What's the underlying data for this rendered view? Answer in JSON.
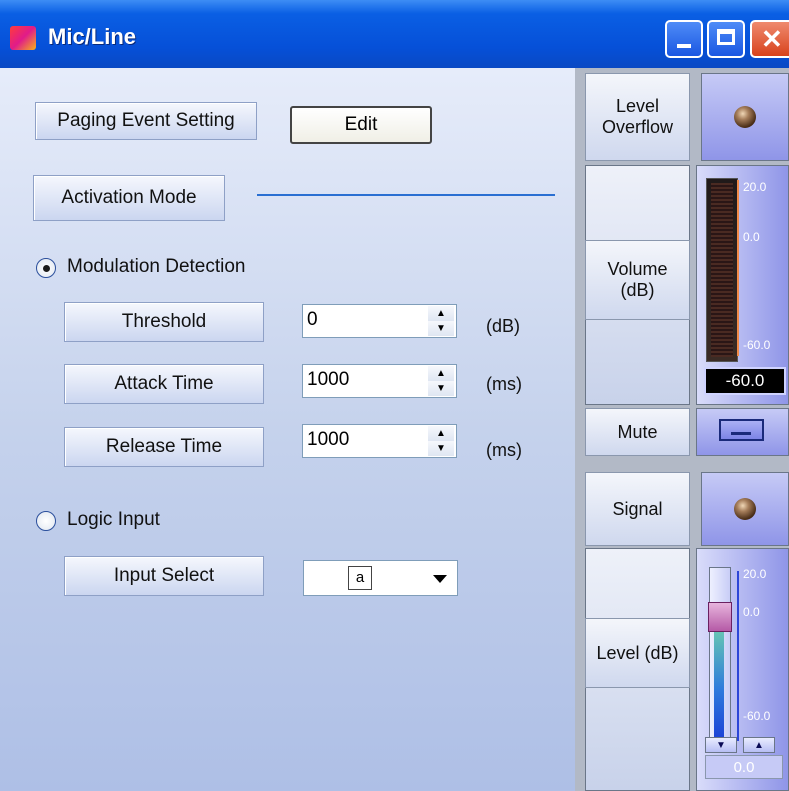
{
  "window": {
    "title": "Mic/Line"
  },
  "paging": {
    "label": "Paging Event Setting",
    "edit_label": "Edit"
  },
  "activation": {
    "label": "Activation Mode",
    "modulation": {
      "label": "Modulation Detection",
      "checked": true
    },
    "threshold": {
      "label": "Threshold",
      "value": "0",
      "unit": "(dB)"
    },
    "attack": {
      "label": "Attack Time",
      "value": "1000",
      "unit": "(ms)"
    },
    "release": {
      "label": "Release Time",
      "value": "1000",
      "unit": "(ms)"
    },
    "logic": {
      "label": "Logic Input",
      "checked": false
    },
    "input_select": {
      "label": "Input Select",
      "value": "a"
    }
  },
  "right_panel": {
    "level_overflow_label": "Level\nOverflow",
    "volume_label": "Volume\n(dB)",
    "volume_scale": [
      "20.0",
      "0.0",
      "-60.0"
    ],
    "volume_readout": "-60.0",
    "mute_label": "Mute",
    "signal_label": "Signal",
    "level_label": "Level (dB)",
    "level_scale": [
      "20.0",
      "0.0",
      "-60.0"
    ],
    "level_readout": "0.0"
  }
}
